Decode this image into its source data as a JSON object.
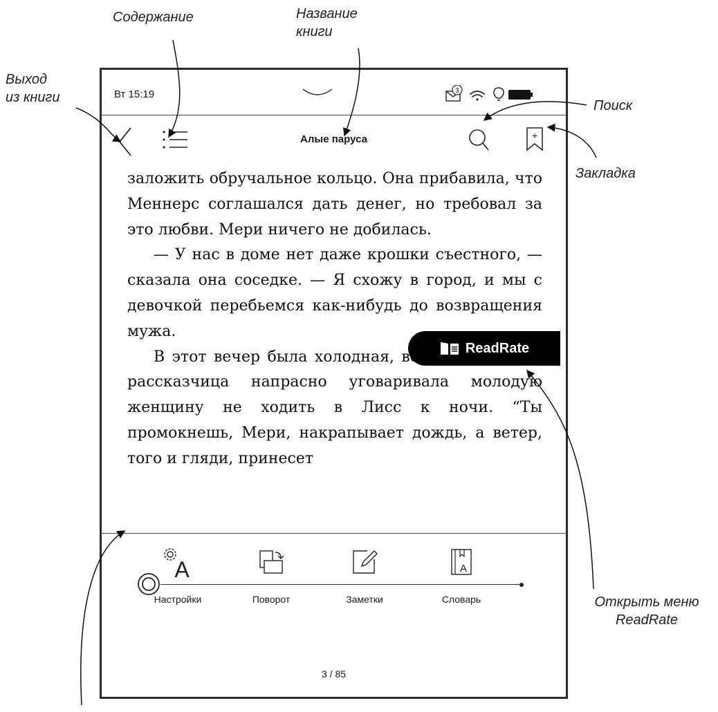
{
  "callouts": {
    "contents": "Содержание",
    "book_title_line1": "Название",
    "book_title_line2": "книги",
    "exit_line1": "Выход",
    "exit_line2": "из книги",
    "search": "Поиск",
    "bookmark": "Закладка",
    "readrate_line1": "Открыть меню",
    "readrate_line2": "ReadRate"
  },
  "status": {
    "time": "Вт 15:19",
    "mail_count": "3"
  },
  "toolbar": {
    "title": "Алые паруса",
    "bookmark_symbol": "+"
  },
  "reader": {
    "paragraphs": [
      {
        "indent": false,
        "text": "заложить обручальное кольцо. Она прибавила, что Меннерс соглашался дать денег, но требовал за это любви. Мери ничего не добилась."
      },
      {
        "indent": true,
        "text": "— У нас в доме нет даже крошки съестного, — сказала она соседке. — Я схожу в город, и мы с девочкой перебьемся как-нибудь до возвращения мужа."
      },
      {
        "indent": true,
        "text": "В этот вечер была холодная, ветреная погода; рассказчица напрасно уговаривала молодую женщину не ходить в Лисс к ночи. “Ты промокнешь, Мери, накрапывает дождь, а ветер, того и гляди, принесет"
      }
    ]
  },
  "readrate": {
    "label": "ReadRate"
  },
  "bottom_menu": {
    "settings": "Настройки",
    "rotate": "Поворот",
    "notes": "Заметки",
    "dictionary": "Словарь",
    "dictionary_icon_letter": "A",
    "settings_icon_letter": "A"
  },
  "pagination": {
    "page": "3 / 85",
    "current": 3,
    "total": 85
  }
}
